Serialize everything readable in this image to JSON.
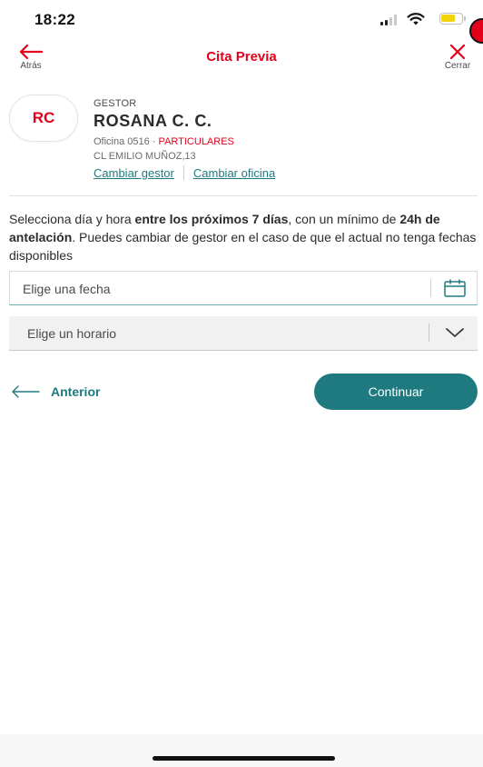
{
  "status_bar": {
    "time": "18:22"
  },
  "header": {
    "title": "Cita Previa",
    "back_label": "Atrás",
    "close_label": "Cerrar"
  },
  "manager": {
    "initials": "RC",
    "role": "GESTOR",
    "name": "ROSANA C. C.",
    "office_prefix": "Oficina 0516 · ",
    "segment": "PARTICULARES",
    "address": "CL EMILIO MUÑOZ,13",
    "change_manager_link": "Cambiar gestor",
    "change_office_link": "Cambiar oficina"
  },
  "instructions": {
    "part1": "Selecciona día y hora ",
    "bold1": "entre los próximos 7 días",
    "part2": ", con un mínimo de ",
    "bold2": "24h de antelación",
    "part3": ". Puedes cambiar de gestor en el caso de que el actual no tenga fechas disponibles"
  },
  "form": {
    "date_placeholder": "Elige una fecha",
    "time_placeholder": "Elige un horario"
  },
  "actions": {
    "previous_label": "Anterior",
    "continue_label": "Continuar"
  },
  "colors": {
    "brand_red": "#e4001b",
    "accent_teal": "#1f7a80",
    "battery_yellow": "#f1d40d"
  },
  "icons": {
    "back": "arrow-left-icon",
    "close": "close-icon",
    "calendar": "calendar-icon",
    "dropdown": "chevron-down-icon",
    "previous": "arrow-left-thin-icon"
  }
}
